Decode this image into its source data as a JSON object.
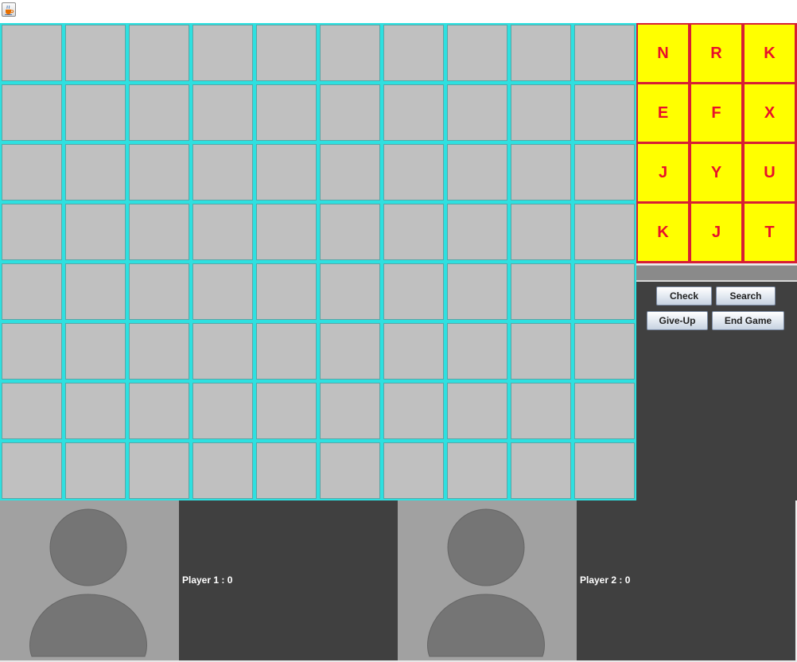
{
  "board": {
    "columns": 10,
    "rows": 8
  },
  "letter_grid": {
    "rows": [
      [
        "N",
        "R",
        "K"
      ],
      [
        "E",
        "F",
        "X"
      ],
      [
        "J",
        "Y",
        "U"
      ],
      [
        "K",
        "J",
        "T"
      ]
    ]
  },
  "word_field": {
    "value": ""
  },
  "buttons": {
    "check": "Check",
    "search": "Search",
    "give_up": "Give-Up",
    "end_game": "End Game"
  },
  "players": [
    {
      "label": "Player 1 : 0"
    },
    {
      "label": "Player 2 : 0"
    }
  ],
  "colors": {
    "board_grid_line": "#2ee0e0",
    "board_cell": "#c0c0c0",
    "letter_tile": "#ffff00",
    "letter_text": "#e8102a",
    "letter_grid_line": "#d71f33",
    "panel_background": "#404040",
    "avatar_background": "#a1a1a1",
    "avatar_silhouette": "#757575"
  },
  "icons": {
    "window_icon": "java-coffee-cup-icon",
    "player_avatar": "default-user-silhouette-icon"
  }
}
